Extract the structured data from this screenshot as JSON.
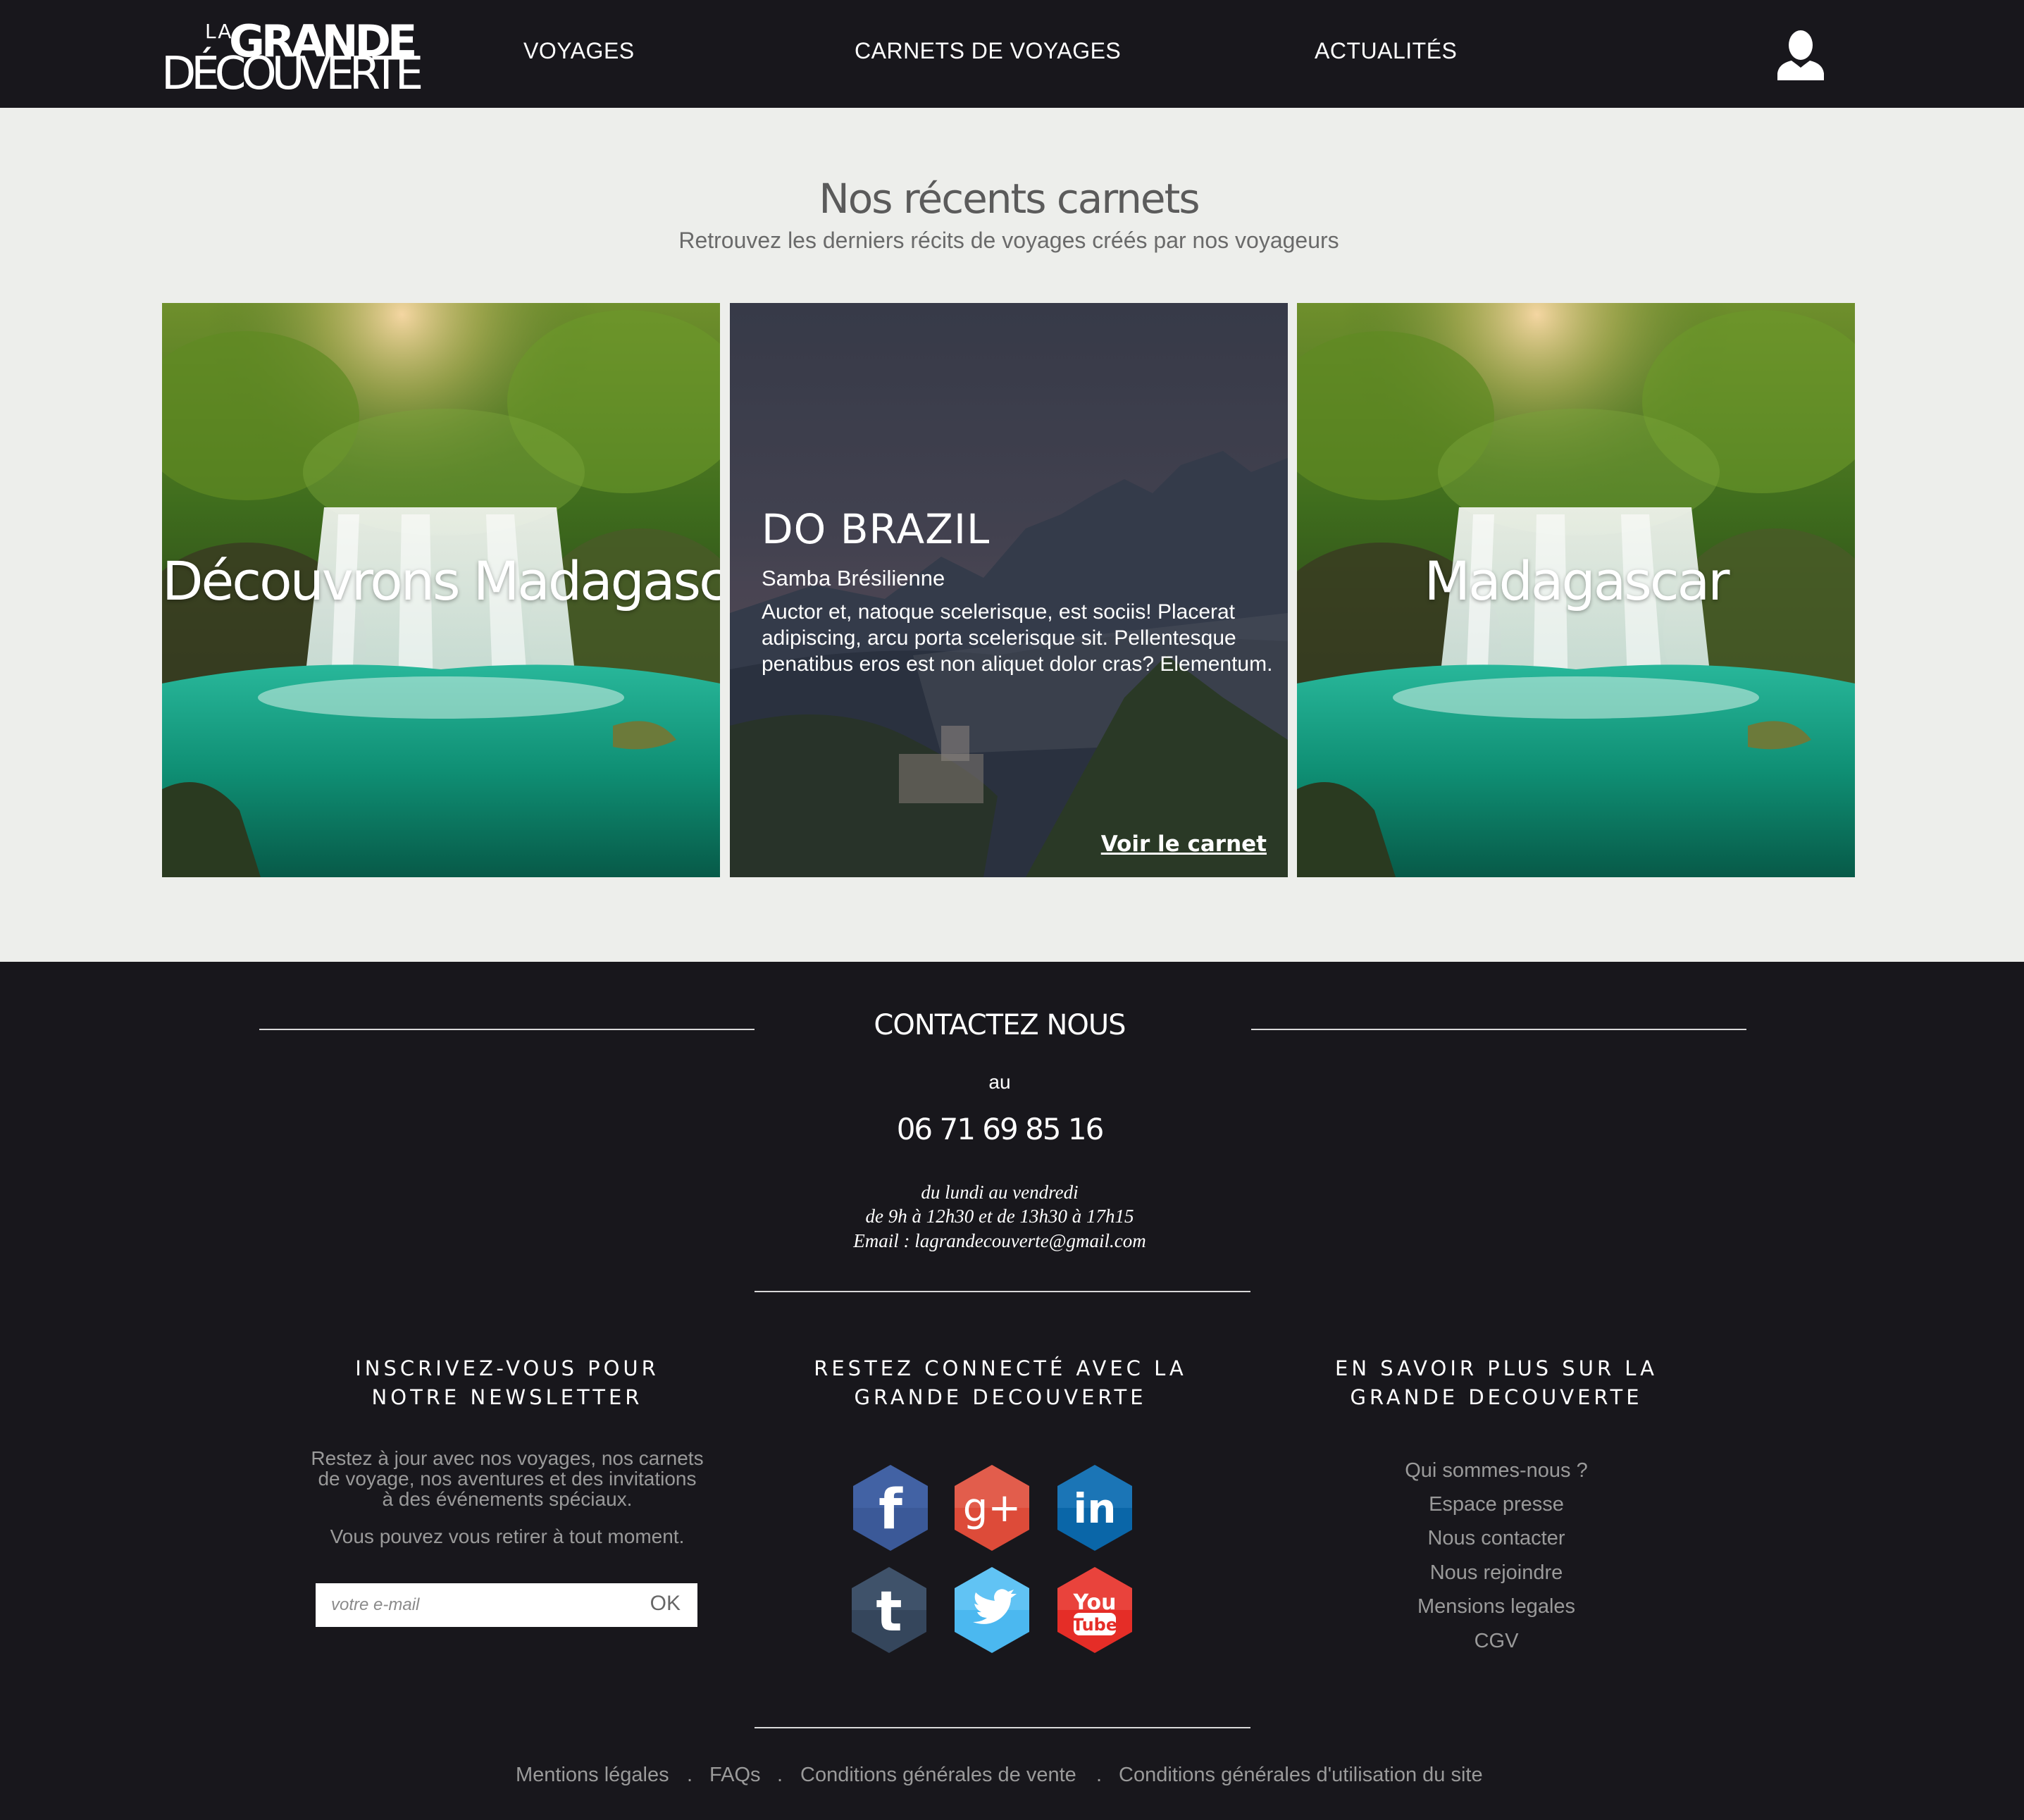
{
  "header": {
    "logo": {
      "la": "LA",
      "grande": "GRANDE",
      "decouverte": "DÉCOUVERTE"
    },
    "nav": [
      "VOYAGES",
      "CARNETS DE VOYAGES",
      "ACTUALITÉS"
    ],
    "user_icon": "user-icon"
  },
  "recent": {
    "title": "Nos récents carnets",
    "subtitle": "Retrouvez les derniers récits de voyages créés par nos voyageurs",
    "cards": [
      {
        "title": "Découvrons Madagascar",
        "image": "waterfall"
      },
      {
        "title": "DO BRAZIL",
        "subtitle": "Samba Brésilienne",
        "text": "Auctor et, natoque scelerisque, est sociis! Placerat adipiscing, arcu porta scelerisque sit. Pellentesque penatibus eros est non aliquet dolor cras? Elementum.",
        "link": "Voir le carnet",
        "image": "rio-night"
      },
      {
        "title": "Madagascar",
        "image": "waterfall"
      }
    ]
  },
  "contact": {
    "title": "CONTACTEZ NOUS",
    "au": "au",
    "phone": "06 71 69 85 16",
    "days": "du lundi au vendredi",
    "hours": "de 9h à 12h30 et de 13h30 à 17h15",
    "email": "Email : lagrandecouverte@gmail.com"
  },
  "newsletter": {
    "title": "INSCRIVEZ-VOUS POUR NOTRE NEWSLETTER",
    "text": "Restez à jour avec nos voyages, nos carnets de voyage, nos aventures et des invitations à des événements spéciaux.",
    "text2": "Vous pouvez vous retirer à tout moment.",
    "placeholder": "votre e-mail",
    "button": "OK"
  },
  "social": {
    "title": "RESTEZ CONNECTÉ AVEC LA GRANDE DECOUVERTE",
    "items": [
      {
        "name": "facebook-icon",
        "color": "#3b5998"
      },
      {
        "name": "google-plus-icon",
        "color": "#dd4b39"
      },
      {
        "name": "linkedin-icon",
        "color": "#0a66a8"
      },
      {
        "name": "tumblr-icon",
        "color": "#35465c"
      },
      {
        "name": "twitter-icon",
        "color": "#4bb8f0"
      },
      {
        "name": "youtube-icon",
        "color": "#e52d27"
      }
    ],
    "glyphs": {
      "facebook": "f",
      "gplus": "g+",
      "linkedin": "in",
      "tumblr": "t",
      "youtube_you": "You",
      "youtube_tube": "Tube"
    }
  },
  "info": {
    "title": "EN SAVOIR PLUS SUR LA GRANDE DECOUVERTE",
    "links": [
      "Qui sommes-nous ?",
      "Espace presse",
      "Nous contacter",
      "Nous rejoindre",
      "Mensions legales",
      "CGV"
    ]
  },
  "bottom": {
    "links": [
      "Mentions légales",
      "FAQs",
      "Conditions générales de vente",
      "Conditions générales d'utilisation du site"
    ],
    "separator": "."
  },
  "colors": {
    "header_bg": "#18171c",
    "section_bg": "#edeeeb",
    "footer_bg": "#18171c"
  }
}
